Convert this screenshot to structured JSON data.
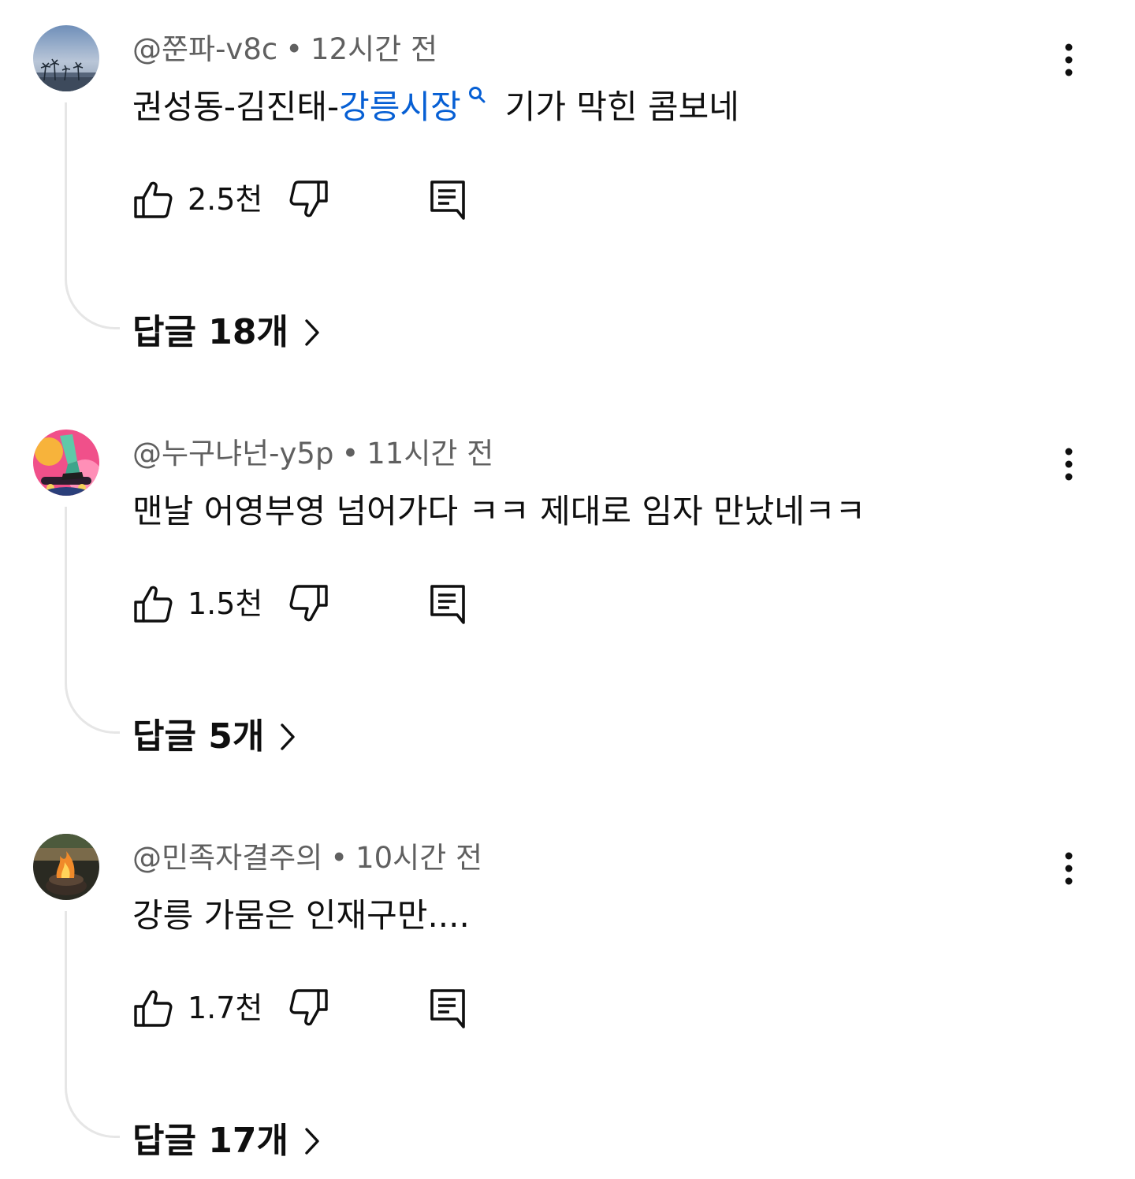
{
  "comments": [
    {
      "author": "@쭌파-v8c",
      "time": "12시간 전",
      "separator": "•",
      "text_before": "권성동-김진태-",
      "text_link": "강릉시장",
      "text_after": "기가 막힌 콤보네",
      "likes": "2.5천",
      "replies": "답글 18개"
    },
    {
      "author": "@누구냐넌-y5p",
      "time": "11시간 전",
      "separator": "•",
      "text": "맨날 어영부영 넘어가다 ㅋㅋ 제대로 임자 만났네ㅋㅋ",
      "likes": "1.5천",
      "replies": "답글 5개"
    },
    {
      "author": "@민족자결주의",
      "time": "10시간 전",
      "separator": "•",
      "text": "강릉 가뭄은 인재구만....",
      "likes": "1.7천",
      "replies": "답글 17개"
    }
  ],
  "icons": {
    "like": "thumbs-up-icon",
    "dislike": "thumbs-down-icon",
    "reply": "comment-reply-icon",
    "more": "more-vertical-icon",
    "chevron": "chevron-right-icon",
    "search": "search-icon"
  },
  "colors": {
    "text": "#0f0f0f",
    "secondary": "#606060",
    "link": "#065fd4",
    "thread_line": "#e6e6e6"
  }
}
